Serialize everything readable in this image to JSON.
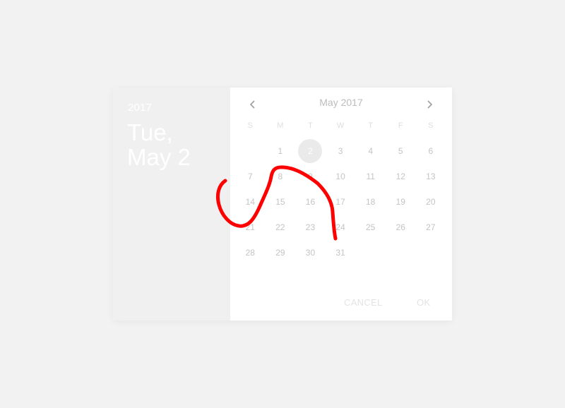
{
  "header": {
    "year": "2017",
    "date_line1": "Tue,",
    "date_line2": "May 2"
  },
  "calendar": {
    "month_title": "May 2017",
    "prev_icon": "chevron-left-icon",
    "next_icon": "chevron-right-icon",
    "weekdays": [
      "S",
      "M",
      "T",
      "W",
      "T",
      "F",
      "S"
    ],
    "weeks": [
      [
        "",
        "1",
        "2",
        "3",
        "4",
        "5",
        "6"
      ],
      [
        "7",
        "8",
        "9",
        "10",
        "11",
        "12",
        "13"
      ],
      [
        "14",
        "15",
        "16",
        "17",
        "18",
        "19",
        "20"
      ],
      [
        "21",
        "22",
        "23",
        "24",
        "25",
        "26",
        "27"
      ],
      [
        "28",
        "29",
        "30",
        "31",
        "",
        "",
        ""
      ]
    ],
    "selected_day": "2"
  },
  "actions": {
    "cancel_label": "CANCEL",
    "ok_label": "OK"
  },
  "colors": {
    "background": "#f2f2f2",
    "header_panel": "#f0f0f0",
    "selected_circle": "#eaeaea",
    "annotation_stroke": "#ff0000"
  }
}
